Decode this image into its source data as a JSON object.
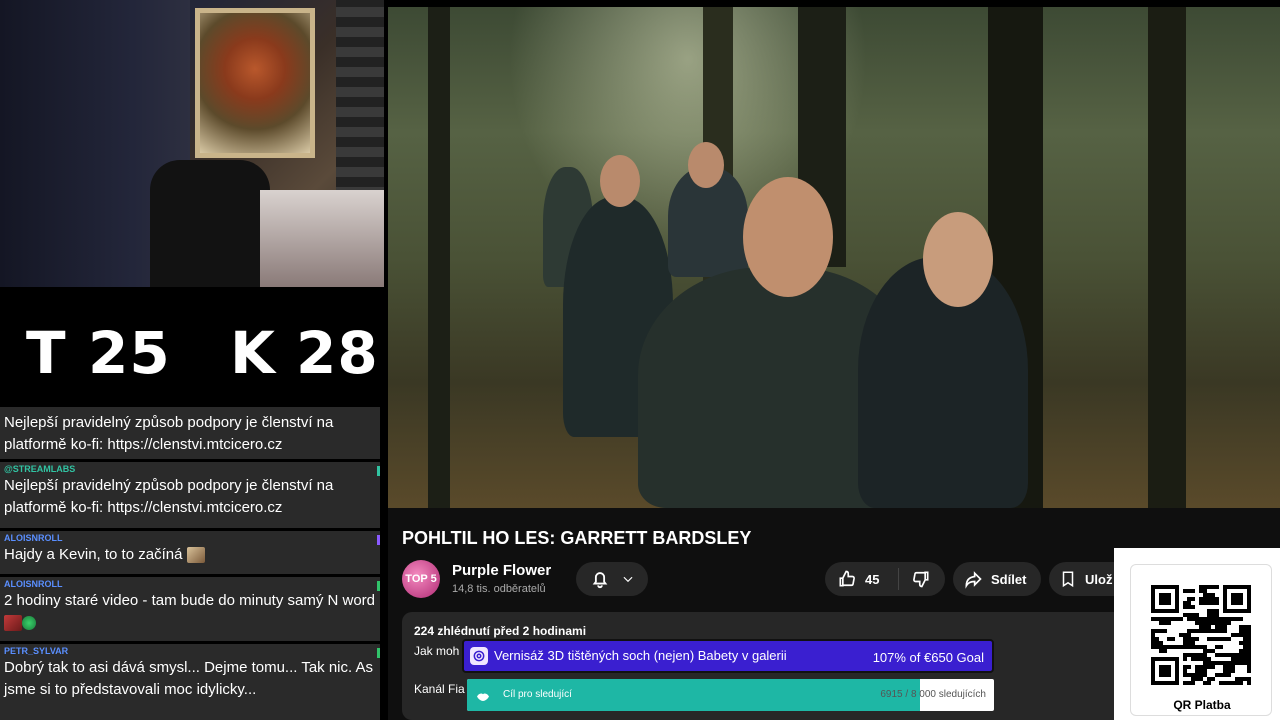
{
  "scoreboard": {
    "t_label": "T",
    "t_value": "25",
    "k_label": "K",
    "k_value": "28"
  },
  "chat": {
    "messages": [
      {
        "user": "",
        "user_color": "#ffffff",
        "text": "Nejlepší pravidelný způsob podpory je členství na platformě ko-fi: https://clenstvi.mtcicero.cz"
      },
      {
        "user": "@STREAMLABS",
        "user_color": "#31c3a2",
        "text": "Nejlepší pravidelný způsob podpory je členství na platformě ko-fi: https://clenstvi.mtcicero.cz"
      },
      {
        "user": "ALOISNROLL",
        "user_color": "#5a8fff",
        "text": "Hajdy a Kevin, to to začíná"
      },
      {
        "user": "ALOISNROLL",
        "user_color": "#5a8fff",
        "text": "2 hodiny staré video - tam bude do minuty samý N word"
      },
      {
        "user": "PETR_SYLVAR",
        "user_color": "#5a8fff",
        "text": "Dobrý tak to asi dává smysl... Dejme tomu... Tak nic. As jsme si to představovali moc idylicky..."
      }
    ]
  },
  "video": {
    "title": "POHLTIL HO LES: GARRETT BARDSLEY",
    "channel_name": "Purple Flower",
    "channel_avatar_text": "TOP 5",
    "subscribers": "14,8 tis. odběratelů",
    "likes": "45",
    "share_label": "Sdílet",
    "save_label": "Ulož",
    "meta": "224 zhlédnutí  před 2 hodinami",
    "desc_line1": "Jak moh",
    "desc_line2": "Kanál Fia"
  },
  "goals": {
    "goal1_title": "Vernisáž 3D tištěných soch (nejen) Babety v galerii",
    "goal1_value": "107% of €650 Goal",
    "goal2_label": "Cíl pro sledující",
    "goal2_value": "6915 / 8 000 sledujících",
    "goal2_progress": 0.86,
    "goal1_color": "#3a1fd0",
    "goal2_color": "#1eb7a5"
  },
  "qr": {
    "label": "QR Platba"
  },
  "colors": {
    "page_bg": "#0f0f0f",
    "pill_bg": "#272727",
    "chat_bg": "#2a2a2a"
  }
}
